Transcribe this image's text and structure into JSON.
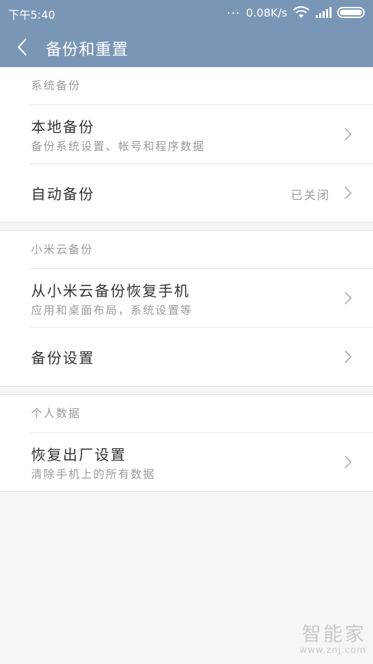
{
  "status_bar": {
    "time": "下午5:40",
    "dots": "...",
    "speed": "0.08K/s",
    "icons": [
      "wifi-icon",
      "signal-icon",
      "battery-icon"
    ]
  },
  "header": {
    "back_icon": "chevron-left-icon",
    "title": "备份和重置"
  },
  "sections": [
    {
      "title": "系统备份",
      "items": [
        {
          "label": "本地备份",
          "subtitle": "备份系统设置、帐号和程序数据"
        },
        {
          "label": "自动备份",
          "value": "已关闭"
        }
      ]
    },
    {
      "title": "小米云备份",
      "items": [
        {
          "label": "从小米云备份恢复手机",
          "subtitle": "应用和桌面布局，系统设置等"
        },
        {
          "label": "备份设置"
        }
      ]
    },
    {
      "title": "个人数据",
      "items": [
        {
          "label": "恢复出厂设置",
          "subtitle": "清除手机上的所有数据"
        }
      ]
    }
  ],
  "watermark": {
    "text": "智能家",
    "url": "www.znj.com"
  },
  "colors": {
    "header": "#7a96b6",
    "background": "#f5f6f7"
  }
}
